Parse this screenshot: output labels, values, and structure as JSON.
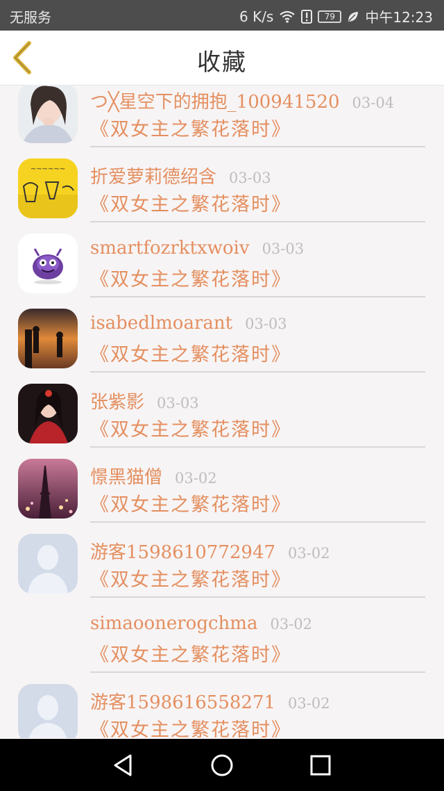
{
  "status_bar": {
    "carrier": "无服务",
    "speed": "6  K/s",
    "battery": "79",
    "time": "中午12:23"
  },
  "header": {
    "title": "收藏"
  },
  "favorites": [
    {
      "name": "つ╳星空下的拥抱_100941520",
      "date": "03-04",
      "title": "《双女主之繁花落时》",
      "avatar": "portrait-girl"
    },
    {
      "name": "折爱萝莉德绍含",
      "date": "03-03",
      "title": "《双女主之繁花落时》",
      "avatar": "yellow-drawing"
    },
    {
      "name": "smartfozrktxwoiv",
      "date": "03-03",
      "title": "《双女主之繁花落时》",
      "avatar": "purple-monster"
    },
    {
      "name": "isabedlmoarant",
      "date": "03-03",
      "title": "《双女主之繁花落时》",
      "avatar": "sunset-couple"
    },
    {
      "name": "张紫影",
      "date": "03-03",
      "title": "《双女主之繁花落时》",
      "avatar": "red-costume-girl"
    },
    {
      "name": "憬黑猫僧",
      "date": "03-02",
      "title": "《双女主之繁花落时》",
      "avatar": "eiffel-tower"
    },
    {
      "name": "游客1598610772947",
      "date": "03-02",
      "title": "《双女主之繁花落时》",
      "avatar": "default-user"
    },
    {
      "name": "simaoonerogchma",
      "date": "03-02",
      "title": "《双女主之繁花落时》",
      "avatar": "none"
    },
    {
      "name": "游客1598616558271",
      "date": "03-02",
      "title": "《双女主之繁花落时》",
      "avatar": "default-user"
    }
  ],
  "colors": {
    "accent": "#e48f60",
    "back_arrow": "#d9b23a",
    "date": "#bdbdbd"
  },
  "nav": {
    "back_icon": "triangle-back-icon",
    "home_icon": "circle-home-icon",
    "recents_icon": "square-recents-icon"
  }
}
